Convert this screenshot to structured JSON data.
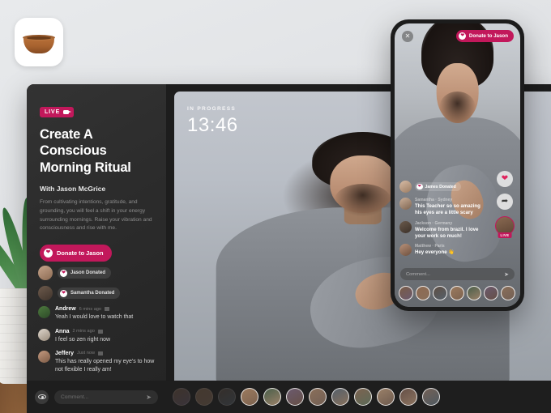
{
  "app": {
    "icon_name": "singing-bowl-app-icon"
  },
  "desktop": {
    "sidebar": {
      "live_badge": "LIVE",
      "title": "Create A Conscious Morning Ritual",
      "host": "With Jason McGrice",
      "description": "From cultivating intentions, gratitude, and grounding, you will feel a shift in your energy surrounding mornings. Raise your vibration and consciousness and rise with me.",
      "donate_label": "Donate to Jason",
      "donations": [
        {
          "name": "Jason Donated"
        },
        {
          "name": "Samantha Donated"
        }
      ],
      "comments": [
        {
          "name": "Andrew",
          "time": "6 mins ago",
          "text": "Yeah I would love to watch that"
        },
        {
          "name": "Anna",
          "time": "2 mins ago",
          "text": "I feel so zen right now"
        },
        {
          "name": "Jeffery",
          "time": "Just now",
          "text": "This has really opened my eye's to how not flexible I really am!"
        }
      ],
      "composer_placeholder": "Comment...",
      "send_label": "➤"
    },
    "stage": {
      "status_label": "IN PROGRESS",
      "timer": "13:46"
    },
    "viewer_strip": {
      "count": 12
    }
  },
  "phone": {
    "close_label": "✕",
    "donate_label": "Donate to Jason",
    "rail": {
      "heart": "❤",
      "share": "➦",
      "live_badge": "LIVE"
    },
    "donation": {
      "name": "James Donated"
    },
    "comments": [
      {
        "meta": "Samantha · Sydney",
        "text": "This Teacher so so amazing his eyes are a little scary"
      },
      {
        "meta": "Jackson · Germany",
        "text": "Welcome from brazil. I love your work so much!"
      },
      {
        "meta": "Matthew · Paris",
        "text": "Hey everyone 👋"
      }
    ],
    "composer_placeholder": "Comment...",
    "send_label": "➤",
    "strip": {
      "count": 7
    }
  },
  "colors": {
    "accent": "#c2185b",
    "window_bg": "#262626",
    "sidebar_bg": "#2b2b2b",
    "bar_bg": "#1e1e1e",
    "backdrop": "#e3e5e8"
  },
  "avatars": [
    "#7a5c46",
    "#8d6a52",
    "#5f4f44",
    "#9b7a5e",
    "#4a5f4a",
    "#6b5a6e",
    "#8a6f5a",
    "#55606b",
    "#7d6350",
    "#9a8068",
    "#665047",
    "#736055",
    "#87705c",
    "#5c6a58",
    "#6e5b4f",
    "#8b7360",
    "#4f5a62",
    "#7a6a58",
    "#96775f",
    "#6a5d52"
  ]
}
